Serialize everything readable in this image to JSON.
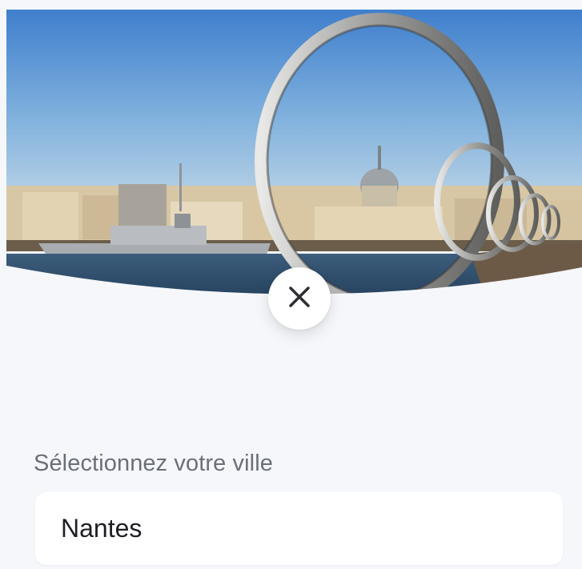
{
  "hero": {
    "image": "nantes-city-with-rings-photo"
  },
  "close_button": {
    "icon": "close-icon"
  },
  "city_select": {
    "label": "Sélectionnez votre ville",
    "value": "Nantes"
  },
  "colors": {
    "background": "#f5f7fb",
    "field_background": "#ffffff",
    "label_text": "#6b6f78",
    "value_text": "#1d1f24"
  }
}
